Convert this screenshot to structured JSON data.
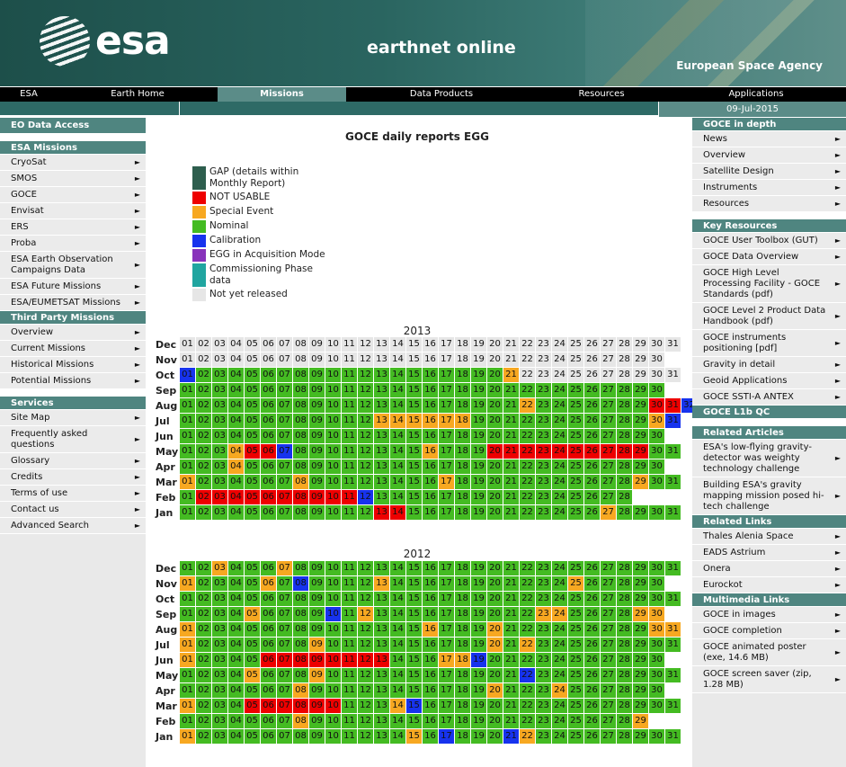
{
  "header": {
    "logo_text": "esa",
    "title": "earthnet online",
    "agency": "European Space Agency"
  },
  "nav": [
    {
      "label": "ESA",
      "w": 64,
      "active": false
    },
    {
      "label": "Earth Home",
      "w": 178,
      "active": false
    },
    {
      "label": "Missions",
      "w": 143,
      "active": true
    },
    {
      "label": "Data Products",
      "w": 212,
      "active": false
    },
    {
      "label": "Resources",
      "w": 144,
      "active": false
    },
    {
      "label": "Applications",
      "w": 200,
      "active": false
    }
  ],
  "date": "09-Jul-2015",
  "left": {
    "eo_access": "EO Data Access",
    "esa_missions_head": "ESA Missions",
    "esa_missions": [
      "CryoSat",
      "SMOS",
      "GOCE",
      "Envisat",
      "ERS",
      "Proba",
      "ESA Earth Observation Campaigns Data",
      "ESA Future Missions",
      "ESA/EUMETSAT Missions"
    ],
    "third_head": "Third Party Missions",
    "third": [
      "Overview",
      "Current Missions",
      "Historical Missions",
      "Potential Missions"
    ],
    "services_head": "Services",
    "services": [
      "Site Map",
      "Frequently asked questions",
      "Glossary",
      "Credits",
      "Terms of use",
      "Contact us",
      "Advanced Search"
    ]
  },
  "right": {
    "depth_head": "GOCE in depth",
    "depth": [
      "News",
      "Overview",
      "Satellite Design",
      "Instruments",
      "Resources"
    ],
    "key_head": "Key Resources",
    "key": [
      "GOCE User Toolbox (GUT)",
      "GOCE Data Overview",
      "GOCE High Level Processing Facility - GOCE Standards (pdf)",
      "GOCE Level 2 Product Data Handbook (pdf)",
      "GOCE instruments positioning [pdf]",
      "Gravity in detail",
      "Geoid Applications",
      "GOCE SSTI-A ANTEX"
    ],
    "l1b_head": "GOCE L1b QC",
    "articles_head": "Related Articles",
    "articles": [
      "ESA's low-flying gravity-detector was weighty technology challenge",
      "Building ESA's gravity mapping mission posed hi-tech challenge"
    ],
    "links_head": "Related Links",
    "links": [
      "Thales Alenia Space",
      "EADS Astrium",
      "Onera",
      "Eurockot"
    ],
    "multimedia_head": "Multimedia Links",
    "multimedia": [
      "GOCE in images",
      "GOCE completion",
      "GOCE animated poster (exe, 14.6 MB)",
      "GOCE screen saver (zip, 1.28 MB)"
    ]
  },
  "main": {
    "title": "GOCE daily reports EGG"
  },
  "legend": [
    {
      "label": "GAP (details within Monthly Report)",
      "color": "#2e5e4e"
    },
    {
      "label": "NOT USABLE",
      "color": "#ee0000"
    },
    {
      "label": "Special Event",
      "color": "#f7a821"
    },
    {
      "label": "Nominal",
      "color": "#44bb22"
    },
    {
      "label": "Calibration",
      "color": "#1733ee"
    },
    {
      "label": "EGG in Acquisition Mode",
      "color": "#8833bb"
    },
    {
      "label": "Commissioning Phase data",
      "color": "#20a5a0"
    },
    {
      "label": "Not yet released",
      "color": "#e6e6e6"
    }
  ],
  "colors": {
    "N": "#44bb22",
    "R": "#ee0000",
    "O": "#f7a821",
    "B": "#1733ee",
    "W": "#e6e6e6"
  },
  "calendar": [
    {
      "year": "2013",
      "months": [
        {
          "name": "Dec",
          "days": "WWWWWWWWWWWWWWWWWWWWWWWWWWWWWWW"
        },
        {
          "name": "Nov",
          "days": "WWWWWWWWWWWWWWWWWWWWWWWWWWWWWW"
        },
        {
          "name": "Oct",
          "days": "BNNNNNNNNNNNNNNNNNNNOWWWWWWWWWW"
        },
        {
          "name": "Sep",
          "days": "NNNNNNNNNNNNNNNNNNNNNNNNNNNNNN"
        },
        {
          "name": "Aug",
          "days": "NNNNNNNNNNNNNNNNNNNNNONNNNNNNRRB"
        },
        {
          "name": "Jul",
          "days": "NNNNNNNNNNNNOOOOOONNNNNNNNNNNOB"
        },
        {
          "name": "Jun",
          "days": "NNNNNNNNNNNNNNNNNNNNNNNNNNNNNN"
        },
        {
          "name": "May",
          "days": "NNNORRBNNNNNNNNONNNRRRRRRRRRRNN"
        },
        {
          "name": "Apr",
          "days": "NNNONNNNNNNNNNNNNNNNNNNNNNNNNN"
        },
        {
          "name": "Mar",
          "days": "ONNNNNNONNNNNNNNONNNNNNNNNNNONN"
        },
        {
          "name": "Feb",
          "days": "NRRRRRRRRRRBNNNNNNNNNNNNNNNN"
        },
        {
          "name": "Jan",
          "days": "NNNNNNNNNNNNRRNNNNNNNNNNNNONNNN"
        }
      ]
    },
    {
      "year": "2012",
      "months": [
        {
          "name": "Dec",
          "days": "NNONNNONNNNNNNNNNNNNNNNNNNNNNNN"
        },
        {
          "name": "Nov",
          "days": "ONNNNONBNNNNONNNNNNNNNNNONNNNN"
        },
        {
          "name": "Oct",
          "days": "NNNNNNNNNNNNNNNNNNNNNNNNNNNNNNN"
        },
        {
          "name": "Sep",
          "days": "NNNNONNNNBNONNNNNNNNNNOONNNNOO"
        },
        {
          "name": "Aug",
          "days": "ONNNNNNNNNNNNNNONNNONNNNNNNNNOO"
        },
        {
          "name": "Jul",
          "days": "ONNNNNNNONNNNNNNNNNONONNNNNNNNN"
        },
        {
          "name": "Jun",
          "days": "ONNNNRRRRRRRRNNNOOBNNNNNNNNNNN"
        },
        {
          "name": "May",
          "days": "NNNNONNNONNNNNNNNNNNNBNNNNNNNNN"
        },
        {
          "name": "Apr",
          "days": "NNNNNNNONNNNNNNNNNNONNNONNNNNN"
        },
        {
          "name": "Mar",
          "days": "ONNNRRRRRRNNNOBNNNNNNNNNNNNNNNN"
        },
        {
          "name": "Feb",
          "days": "NNNNNNNONNNNNNNNNNNNNNNNNNNNO"
        },
        {
          "name": "Jan",
          "days": "ONNNNNNNNNNNNNONBNNNBONNNNNNNNN"
        }
      ]
    }
  ]
}
